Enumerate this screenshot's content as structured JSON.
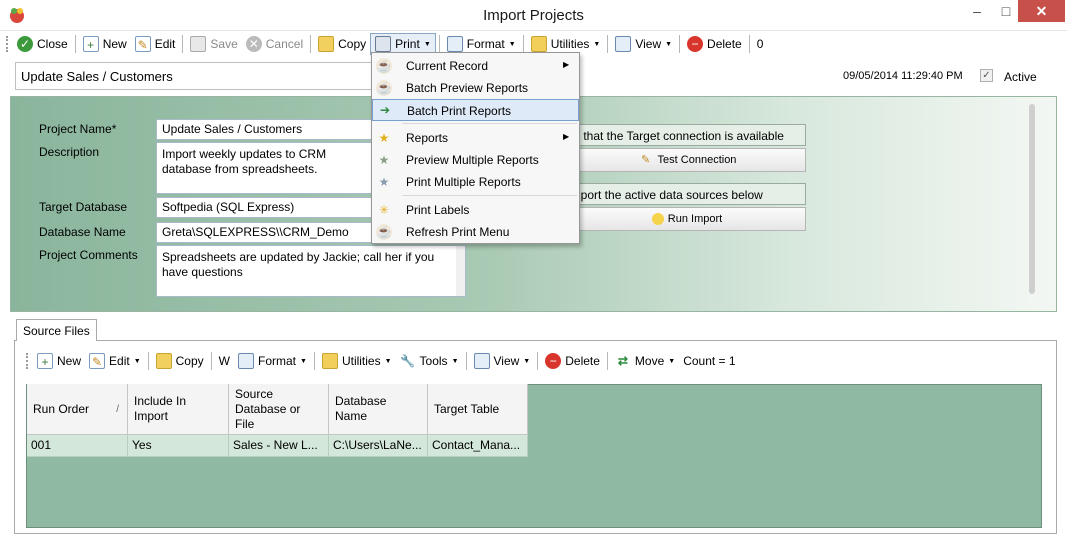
{
  "window": {
    "title": "Import Projects",
    "minimize": "–",
    "maximize": "□",
    "close": "✕"
  },
  "toolbar": {
    "close": "Close",
    "new": "New",
    "edit": "Edit",
    "save": "Save",
    "cancel": "Cancel",
    "copy": "Copy",
    "print": "Print",
    "format": "Format",
    "utilities": "Utilities",
    "view": "View",
    "delete": "Delete",
    "count": "0"
  },
  "header": {
    "project_name": "Update Sales / Customers",
    "datetime": "09/05/2014 11:29:40 PM",
    "active_label": "Active",
    "active_checked": true
  },
  "form": {
    "project_name_label": "Project Name*",
    "project_name_value": "Update Sales / Customers",
    "description_label": "Description",
    "description_value": "Import weekly updates to CRM database from spreadsheets.",
    "target_db_label": "Target Database",
    "target_db_value": "Softpedia (SQL Express)",
    "db_name_label": "Database Name",
    "db_name_value": "Greta\\SQLEXPRESS\\\\CRM_Demo",
    "comments_label": "Project Comments",
    "comments_value": "Spreadsheets are updated by Jackie; call her if you have questions"
  },
  "actions": {
    "verify_text": "y that the Target connection is available",
    "test_connection": "Test Connection",
    "import_text": "nport the active data sources below",
    "run_import": "Run Import"
  },
  "print_menu": {
    "items": [
      {
        "label": "Current Record",
        "submenu": true
      },
      {
        "label": "Batch Preview Reports"
      },
      {
        "label": "Batch Print Reports",
        "highlighted": true
      },
      {
        "label": "Reports",
        "submenu": true
      },
      {
        "label": "Preview Multiple Reports"
      },
      {
        "label": "Print Multiple Reports"
      },
      {
        "label": "Print Labels"
      },
      {
        "label": "Refresh Print Menu"
      }
    ]
  },
  "source_files": {
    "tab": "Source Files",
    "toolbar": {
      "new": "New",
      "edit": "Edit",
      "copy": "Copy",
      "w": "W",
      "format": "Format",
      "utilities": "Utilities",
      "tools": "Tools",
      "view": "View",
      "delete": "Delete",
      "move": "Move",
      "count": "Count = 1"
    },
    "columns": [
      "Run Order",
      "Include In Import",
      "Source Database or File",
      "Database Name",
      "Target Table"
    ],
    "rows": [
      [
        "001",
        "Yes",
        "Sales - New L...",
        "C:\\Users\\LaNe...",
        "Contact_Mana..."
      ]
    ]
  },
  "colors": {
    "panel_green": "#8ab59c",
    "grid_green": "#8fb9a3",
    "highlight": "#dfeaf8",
    "close_red": "#c7504a"
  }
}
